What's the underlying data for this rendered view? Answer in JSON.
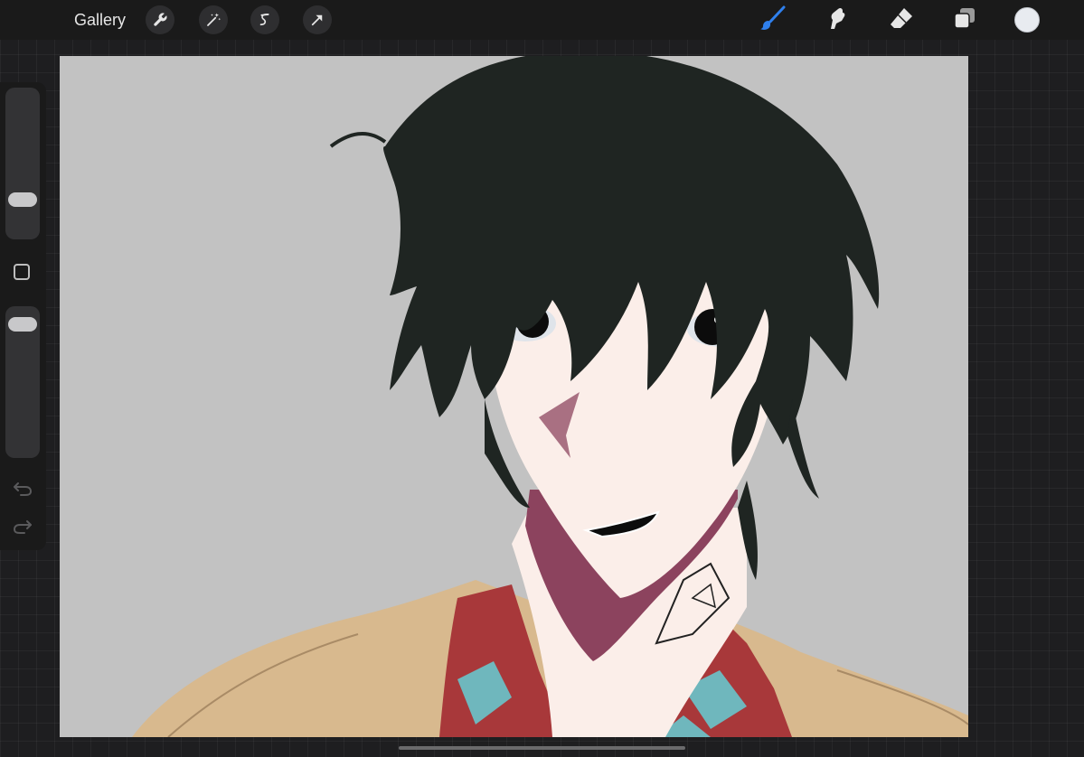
{
  "topbar": {
    "gallery_label": "Gallery",
    "left_tools": [
      "wrench-icon",
      "magic-wand-icon",
      "selection-icon",
      "transform-arrow-icon"
    ],
    "right_tools": [
      "paintbrush-icon",
      "smudge-icon",
      "eraser-icon",
      "layers-icon",
      "color-swatch"
    ],
    "active_tool": "paintbrush-icon",
    "active_color": "#1a73e8",
    "current_color": "#e8ebf0"
  },
  "sidebar": {
    "brush_size_level": 0.78,
    "opacity_level": 0.05,
    "buttons": [
      "modify-button",
      "undo-icon",
      "redo-icon"
    ]
  },
  "canvas": {
    "background_color": "#c2c2c2",
    "artwork": "illustration"
  }
}
